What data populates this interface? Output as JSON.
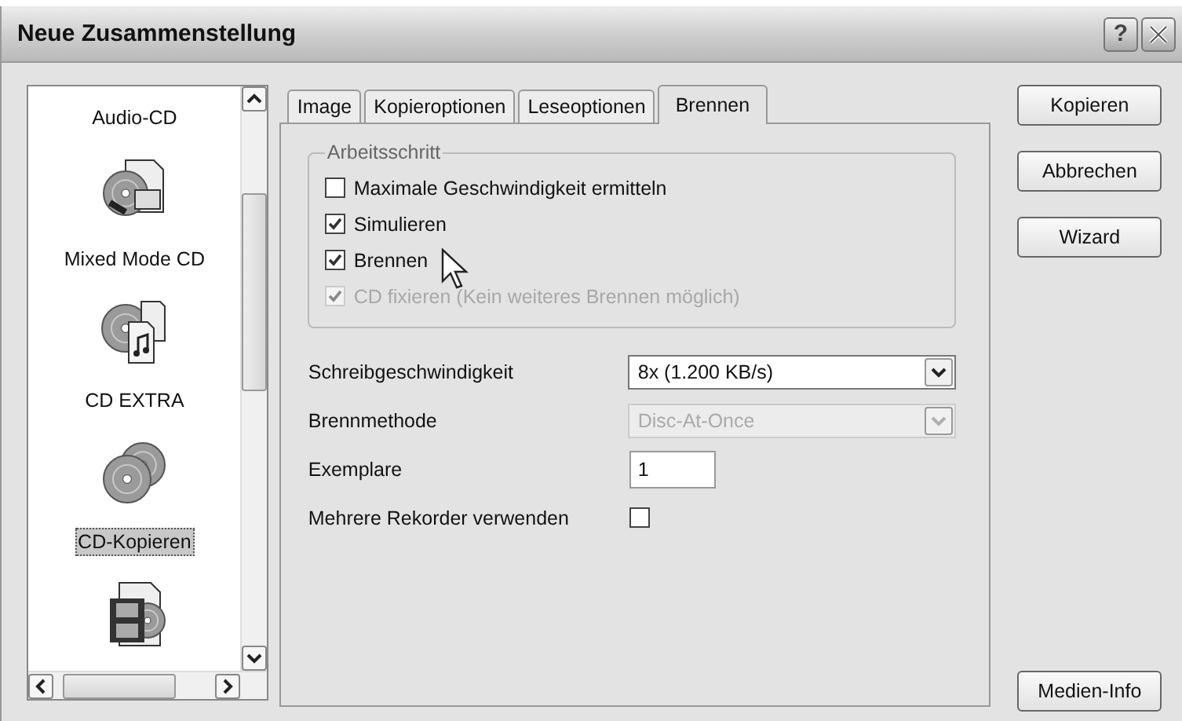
{
  "window": {
    "title": "Neue Zusammenstellung",
    "help": "?"
  },
  "sidebar": {
    "items": [
      {
        "label": "Audio-CD",
        "selected": false
      },
      {
        "label": "Mixed Mode CD",
        "selected": false
      },
      {
        "label": "CD EXTRA",
        "selected": false
      },
      {
        "label": "CD-Kopieren",
        "selected": true
      }
    ]
  },
  "tabs": [
    {
      "label": "Image",
      "selected": false
    },
    {
      "label": "Kopieroptionen",
      "selected": false
    },
    {
      "label": "Leseoptionen",
      "selected": false
    },
    {
      "label": "Brennen",
      "selected": true
    }
  ],
  "group": {
    "title": "Arbeitsschritt",
    "options": [
      {
        "label": "Maximale Geschwindigkeit ermitteln",
        "checked": false,
        "disabled": false
      },
      {
        "label": "Simulieren",
        "checked": true,
        "disabled": false
      },
      {
        "label": "Brennen",
        "checked": true,
        "disabled": false
      },
      {
        "label": "CD fixieren (Kein weiteres Brennen möglich)",
        "checked": true,
        "disabled": true
      }
    ]
  },
  "fields": [
    {
      "kind": "select",
      "label": "Schreibgeschwindigkeit",
      "value": "8x (1.200 KB/s)",
      "disabled": false
    },
    {
      "kind": "select",
      "label": "Brennmethode",
      "value": "Disc-At-Once",
      "disabled": true
    },
    {
      "kind": "input",
      "label": "Exemplare",
      "value": "1",
      "disabled": false
    },
    {
      "kind": "checkbox",
      "label": "Mehrere Rekorder verwenden",
      "checked": false,
      "disabled": false
    }
  ],
  "buttons": [
    "Kopieren",
    "Abbrechen",
    "Wizard"
  ],
  "bottom_button": "Medien-Info"
}
